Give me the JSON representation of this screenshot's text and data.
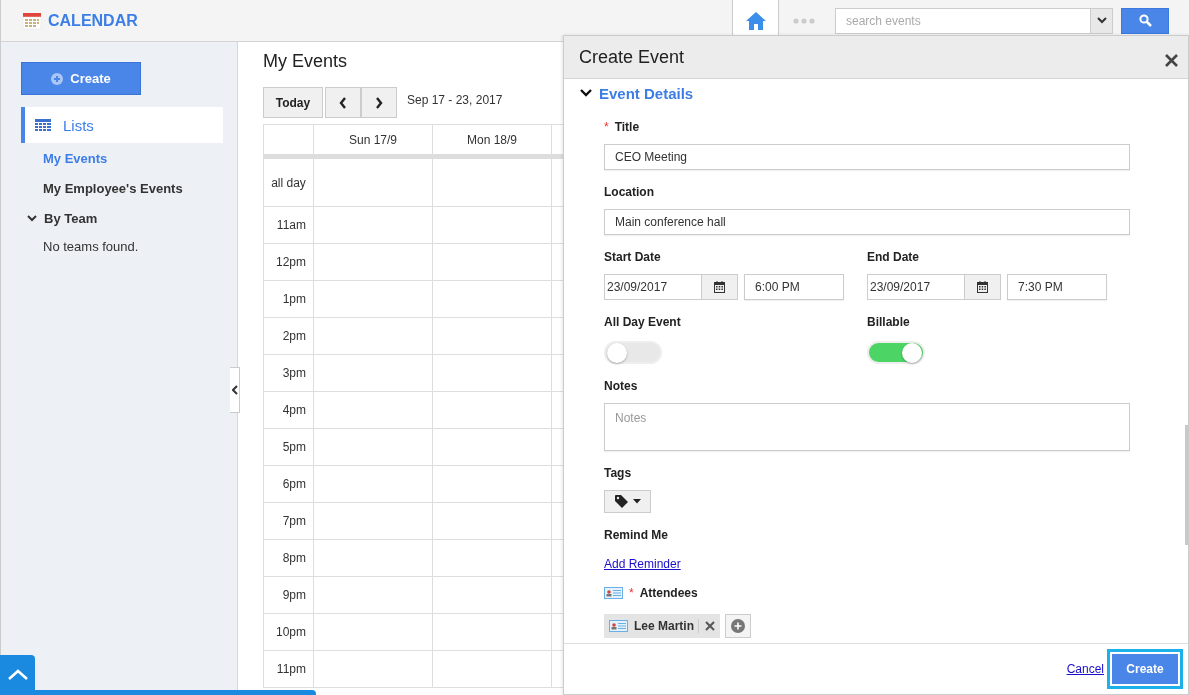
{
  "header": {
    "app_title": "CALENDAR",
    "search": {
      "placeholder": "search events"
    }
  },
  "sidebar": {
    "create_button": "Create",
    "section": {
      "label": "Lists",
      "selected": true
    },
    "items": [
      {
        "label": "My Events",
        "selected": true
      },
      {
        "label": "My Employee's Events",
        "selected": false
      }
    ],
    "team": {
      "label": "By Team",
      "expanded": true,
      "empty_text": "No teams found."
    }
  },
  "calendar": {
    "title": "My Events",
    "today_button": "Today",
    "range": "Sep 17 - 23, 2017",
    "columns": [
      "Sun 17/9",
      "Mon 18/9"
    ],
    "all_day_label": "all day",
    "hours": [
      "11am",
      "12pm",
      "1pm",
      "2pm",
      "3pm",
      "4pm",
      "5pm",
      "6pm",
      "7pm",
      "8pm",
      "9pm",
      "10pm",
      "11pm"
    ]
  },
  "dialog": {
    "title": "Create Event",
    "section": {
      "label": "Event Details",
      "expanded": true
    },
    "title_field": {
      "label": "Title",
      "required_mark": "*",
      "value": "CEO Meeting"
    },
    "location_field": {
      "label": "Location",
      "value": "Main conference hall"
    },
    "start": {
      "label": "Start Date",
      "date": "23/09/2017",
      "time": "6:00 PM"
    },
    "end": {
      "label": "End Date",
      "date": "23/09/2017",
      "time": "7:30 PM"
    },
    "all_day": {
      "label": "All Day Event",
      "on": false
    },
    "billable": {
      "label": "Billable",
      "on": true
    },
    "notes": {
      "label": "Notes",
      "placeholder": "Notes"
    },
    "tags": {
      "label": "Tags"
    },
    "remind": {
      "label": "Remind Me",
      "link": "Add Reminder"
    },
    "attendees": {
      "label": "Attendees",
      "required_mark": "*",
      "items": [
        {
          "name": "Lee Martin"
        }
      ]
    },
    "footer": {
      "cancel": "Cancel",
      "create": "Create"
    }
  }
}
